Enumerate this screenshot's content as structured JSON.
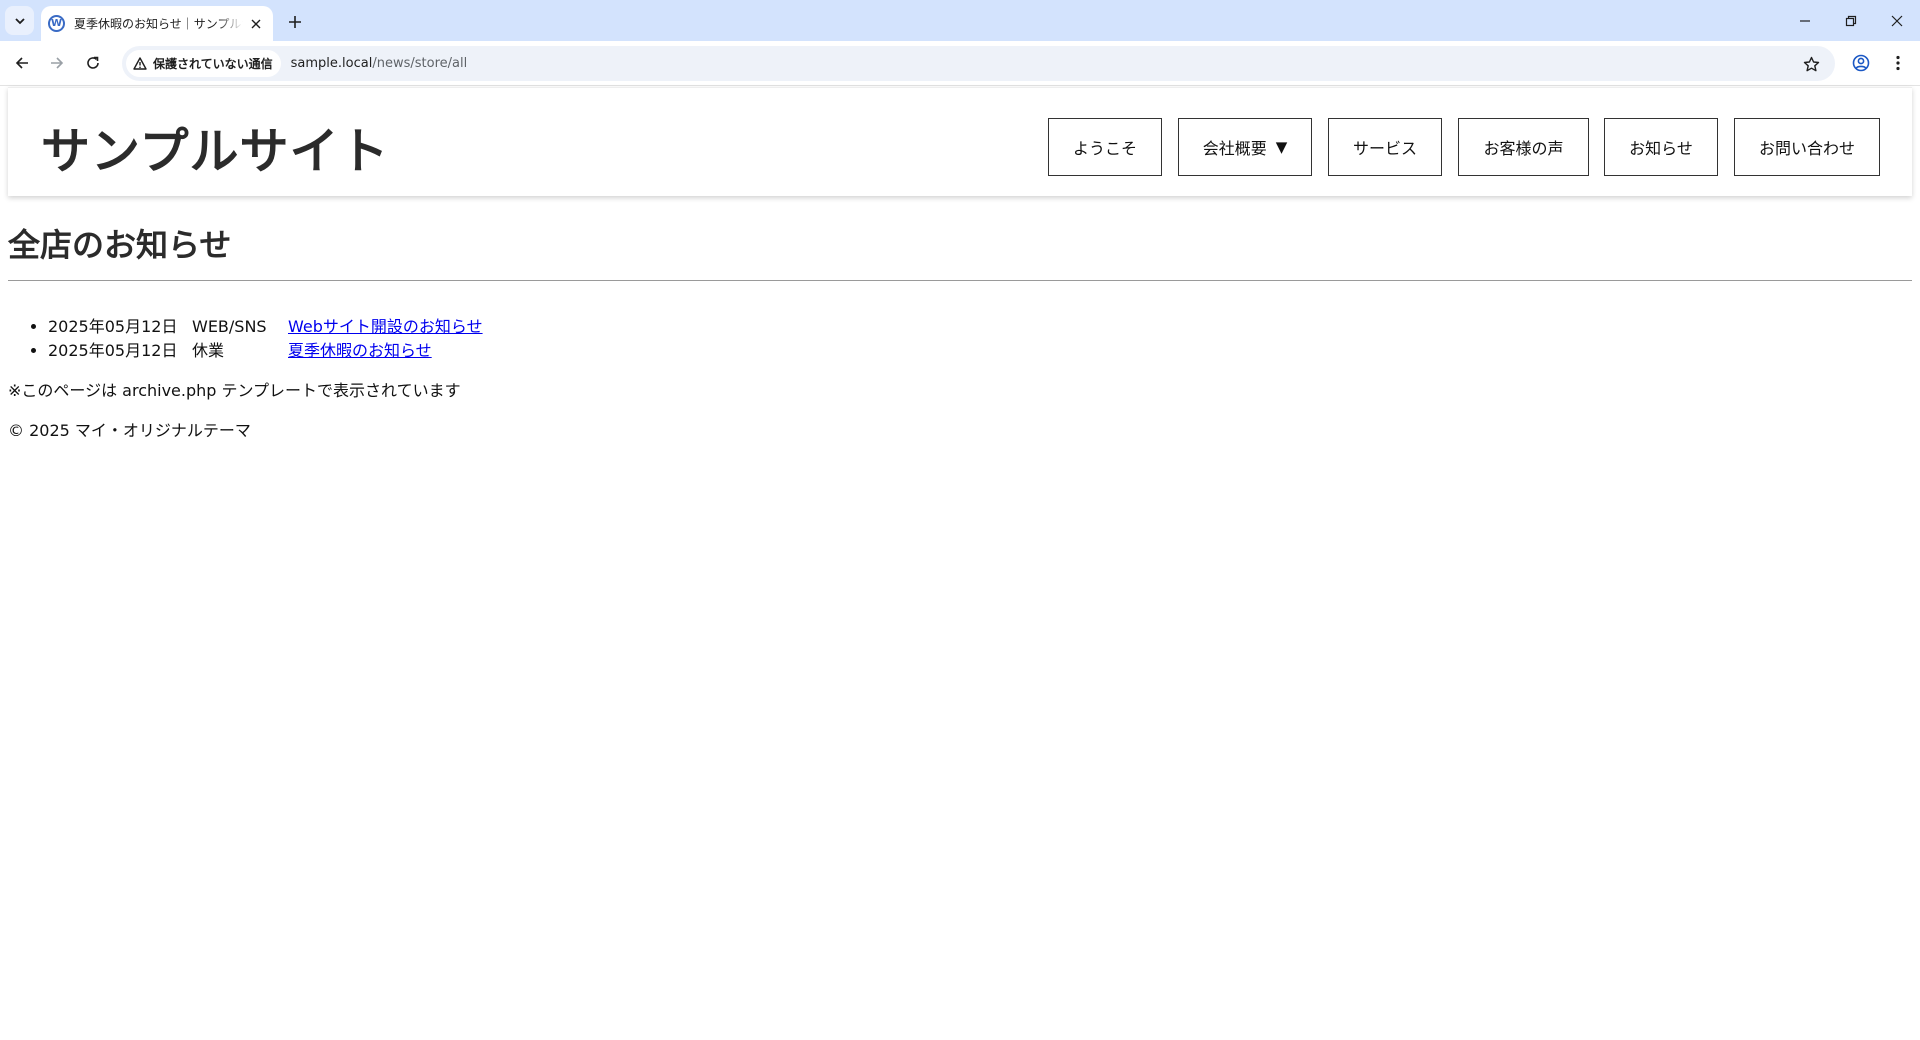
{
  "browser": {
    "tab_title": "夏季休暇のお知らせ｜サンプルサイト",
    "favicon_letter": "W",
    "security_label": "保護されていない通信",
    "url_host": "sample.local",
    "url_path": "/news/store/all"
  },
  "site": {
    "title": "サンプルサイト",
    "nav": [
      {
        "label": "ようこそ"
      },
      {
        "label": "会社概要",
        "caret": "▼"
      },
      {
        "label": "サービス"
      },
      {
        "label": "お客様の声"
      },
      {
        "label": "お知らせ"
      },
      {
        "label": "お問い合わせ"
      }
    ]
  },
  "main": {
    "heading": "全店のお知らせ",
    "news": [
      {
        "date": "2025年05月12日",
        "category": "WEB/SNS",
        "title": "Webサイト開設のお知らせ"
      },
      {
        "date": "2025年05月12日",
        "category": "休業",
        "title": "夏季休暇のお知らせ"
      }
    ],
    "template_note": "※このページは archive.php テンプレートで表示されています"
  },
  "footer": {
    "copyright": "© 2025 マイ・オリジナルテーマ"
  }
}
